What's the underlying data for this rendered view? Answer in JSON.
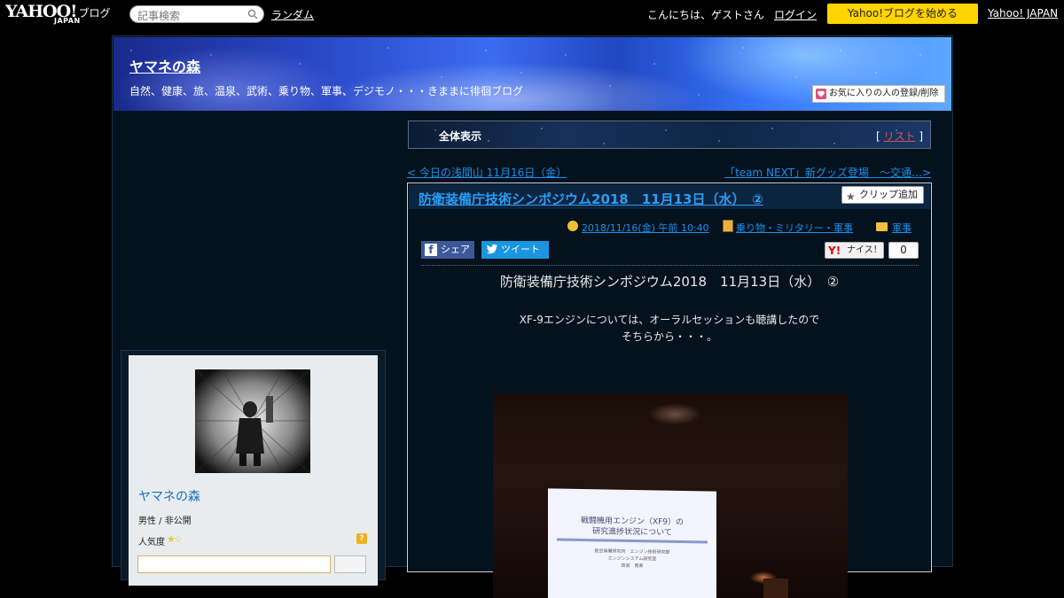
{
  "topbar": {
    "logo_text": "YAHOO!",
    "logo_sub": "JAPAN",
    "logo_blog": "ブログ",
    "search_placeholder": "記事検索",
    "random_label": "ランダム",
    "greeting": "こんにちは、ゲストさん",
    "login_label": "ログイン",
    "start_button": "Yahoo!ブログを始める",
    "yahoo_japan_label": "Yahoo! JAPAN"
  },
  "header": {
    "blog_title": "ヤマネの森",
    "description": "自然、健康、旅、温泉、武術、乗り物、軍事、デジモノ・・・きままに徘徊ブログ",
    "favorite_label": "お気に入りの人の登録/削除"
  },
  "sidebar": {
    "profile_name": "ヤマネの森",
    "gender": "男性 / 非公開",
    "popularity_label": "人気度",
    "popularity_stars": "★☆",
    "help_label": "?"
  },
  "list": {
    "all_label": "全体表示",
    "bracket_open": "[",
    "list_link": "リスト",
    "bracket_close": "]"
  },
  "nav": {
    "prev": "< 今日の浅間山 11月16日（金）",
    "next": "「team NEXT」新グッズ登場　～交通…>"
  },
  "article": {
    "title": "防衛装備庁技術シンポジウム2018　11月13日（水）　②",
    "clip_label": "クリップ追加",
    "date": "2018/11/16(金) 午前 10:40",
    "category": "乗り物・ミリタリー・軍事",
    "tag": "軍事",
    "share_facebook": "シェア",
    "share_twitter": "ツイート",
    "nice_label": "ナイス！",
    "nice_count": "0",
    "body_heading": "防衛装備庁技術シンポジウム2018　11月13日（水）　②",
    "body_line1": "XF-9エンジンについては、オーラルセッションも聴講したので",
    "body_line2": "そちらから・・・。",
    "slide": {
      "title_line1": "戦闘機用エンジン（XF9）の",
      "title_line2": "研究進捗状況について",
      "sub1": "航空装備研究所　エンジン技術研究部",
      "sub2": "エンジンシステム研究室",
      "sub3": "技官　発表"
    }
  }
}
